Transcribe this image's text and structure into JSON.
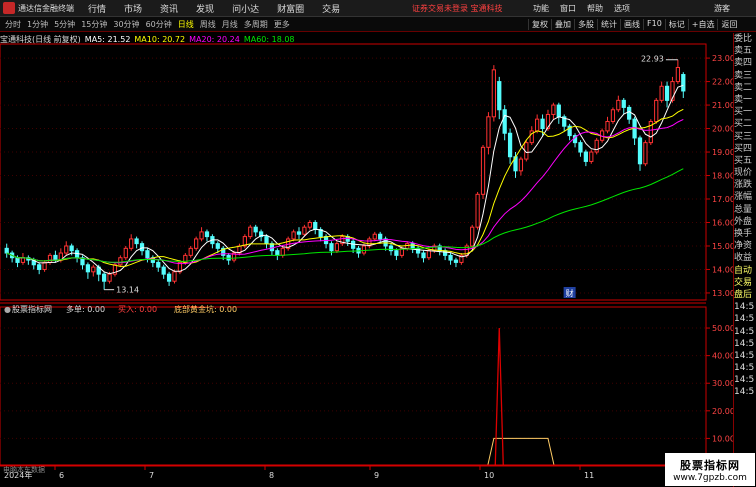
{
  "app": {
    "title": "通达信金融终端"
  },
  "menu": [
    "行情",
    "市场",
    "资讯",
    "发现",
    "问小达",
    "财富圈",
    "交易"
  ],
  "notice": "证券交易未登录  宝通科技",
  "menu_right": [
    "功能",
    "窗口",
    "帮助",
    "选项"
  ],
  "guest": "游客",
  "periods": [
    "分时",
    "1分钟",
    "5分钟",
    "15分钟",
    "30分钟",
    "60分钟",
    "日线",
    "周线",
    "月线",
    "多周期",
    "更多"
  ],
  "active_period": "日线",
  "tools": [
    "复权",
    "叠加",
    "多股",
    "统计",
    "画线",
    "F10",
    "标记",
    "+自选",
    "返回"
  ],
  "legend": {
    "name": "宝通科技(日线 前复权)",
    "ma5": "MA5: 21.52",
    "ma10": "MA10: 20.72",
    "ma20": "MA20: 20.24",
    "ma60": "MA60: 18.08"
  },
  "colors": {
    "up": "#ff3232",
    "down": "#54fcfc",
    "ma5": "#ffffff",
    "ma10": "#ffff00",
    "ma20": "#ff00ff",
    "ma60": "#00e600",
    "grid": "#400000",
    "axis": "#cc0000",
    "signal": "#dd0000",
    "gold": "#ffcc66"
  },
  "indicator": {
    "title": "股票指标网",
    "duo": "多单: 0.00",
    "buy": "买入: 0.00",
    "gold": "底部黄金坑: 0.00",
    "bottom": "电脑本车数据"
  },
  "quote_labels": [
    "委比",
    "卖五",
    "卖四",
    "卖三",
    "卖二",
    "卖一",
    "买一",
    "买二",
    "买三",
    "买四",
    "买五",
    "现价",
    "涨跌",
    "涨幅",
    "总量",
    "外盘",
    "换手",
    "净资",
    "收益",
    "自动",
    "交易",
    "盘后",
    "14:5",
    "14:5",
    "14:5",
    "14:5",
    "14:5",
    "14:5",
    "14:5",
    "14:5"
  ],
  "watermark": {
    "line1": "股票指标网",
    "line2": "www.7gpzb.com"
  },
  "cai_mark": "财",
  "chart_data": {
    "type": "candlestick",
    "y_ticks": [
      "23.00",
      "22.00",
      "21.00",
      "20.00",
      "19.00",
      "18.00",
      "17.00",
      "16.00",
      "15.00",
      "14.00",
      "13.00"
    ],
    "ylim": [
      12.7,
      23.6
    ],
    "x_labels": [
      "2024年",
      "6",
      "7",
      "8",
      "9",
      "10",
      "11"
    ],
    "high_label": "22.93",
    "low_label": "13.14",
    "candles": [
      [
        14.9,
        14.7,
        15.1,
        14.5
      ],
      [
        14.7,
        14.5,
        14.8,
        14.3
      ],
      [
        14.5,
        14.3,
        14.6,
        14.1
      ],
      [
        14.3,
        14.5,
        14.7,
        14.2
      ],
      [
        14.5,
        14.4,
        14.6,
        14.2
      ],
      [
        14.4,
        14.2,
        14.5,
        14.0
      ],
      [
        14.2,
        14.0,
        14.3,
        13.8
      ],
      [
        14.0,
        14.3,
        14.4,
        13.9
      ],
      [
        14.3,
        14.6,
        14.7,
        14.2
      ],
      [
        14.6,
        14.4,
        14.8,
        14.3
      ],
      [
        14.4,
        14.7,
        14.9,
        14.3
      ],
      [
        14.7,
        15.0,
        15.2,
        14.6
      ],
      [
        15.0,
        14.8,
        15.1,
        14.6
      ],
      [
        14.8,
        14.5,
        14.9,
        14.3
      ],
      [
        14.5,
        14.2,
        14.6,
        14.0
      ],
      [
        14.2,
        13.9,
        14.3,
        13.6
      ],
      [
        13.9,
        14.1,
        14.2,
        13.7
      ],
      [
        14.1,
        13.8,
        14.2,
        13.5
      ],
      [
        13.8,
        13.5,
        13.9,
        13.14
      ],
      [
        13.5,
        13.8,
        13.9,
        13.4
      ],
      [
        13.8,
        14.2,
        14.3,
        13.7
      ],
      [
        14.2,
        14.5,
        14.6,
        14.1
      ],
      [
        14.5,
        14.9,
        15.0,
        14.4
      ],
      [
        14.9,
        15.3,
        15.5,
        14.8
      ],
      [
        15.3,
        15.1,
        15.4,
        14.9
      ],
      [
        15.1,
        14.8,
        15.2,
        14.6
      ],
      [
        14.8,
        14.5,
        14.9,
        14.3
      ],
      [
        14.5,
        14.3,
        14.6,
        14.1
      ],
      [
        14.3,
        14.1,
        14.4,
        13.9
      ],
      [
        14.1,
        13.8,
        14.2,
        13.6
      ],
      [
        13.8,
        13.5,
        13.9,
        13.3
      ],
      [
        13.5,
        13.9,
        14.0,
        13.4
      ],
      [
        13.9,
        14.3,
        14.4,
        13.8
      ],
      [
        14.3,
        14.6,
        14.7,
        14.2
      ],
      [
        14.6,
        14.9,
        15.0,
        14.5
      ],
      [
        14.9,
        15.3,
        15.4,
        14.8
      ],
      [
        15.3,
        15.6,
        15.8,
        15.2
      ],
      [
        15.6,
        15.4,
        15.7,
        15.2
      ],
      [
        15.4,
        15.1,
        15.5,
        14.9
      ],
      [
        15.1,
        14.9,
        15.2,
        14.7
      ],
      [
        14.9,
        14.6,
        15.0,
        14.4
      ],
      [
        14.6,
        14.4,
        14.7,
        14.2
      ],
      [
        14.4,
        14.7,
        14.8,
        14.3
      ],
      [
        14.7,
        15.0,
        15.1,
        14.6
      ],
      [
        15.0,
        15.4,
        15.5,
        14.9
      ],
      [
        15.4,
        15.8,
        15.9,
        15.3
      ],
      [
        15.8,
        15.6,
        15.9,
        15.4
      ],
      [
        15.6,
        15.4,
        15.7,
        15.2
      ],
      [
        15.4,
        15.1,
        15.5,
        14.9
      ],
      [
        15.1,
        14.8,
        15.2,
        14.6
      ],
      [
        14.8,
        14.6,
        14.9,
        14.4
      ],
      [
        14.6,
        14.9,
        15.0,
        14.5
      ],
      [
        14.9,
        15.3,
        15.4,
        14.8
      ],
      [
        15.3,
        15.6,
        15.7,
        15.2
      ],
      [
        15.6,
        15.5,
        15.8,
        15.3
      ],
      [
        15.5,
        15.8,
        15.9,
        15.4
      ],
      [
        15.8,
        16.0,
        16.1,
        15.7
      ],
      [
        16.0,
        15.7,
        16.1,
        15.5
      ],
      [
        15.7,
        15.4,
        15.8,
        15.2
      ],
      [
        15.4,
        15.1,
        15.5,
        14.9
      ],
      [
        15.1,
        14.8,
        15.2,
        14.6
      ],
      [
        14.8,
        15.1,
        15.2,
        14.7
      ],
      [
        15.1,
        15.4,
        15.5,
        15.0
      ],
      [
        15.4,
        15.2,
        15.5,
        15.0
      ],
      [
        15.2,
        14.9,
        15.3,
        14.7
      ],
      [
        14.9,
        14.7,
        15.0,
        14.5
      ],
      [
        14.7,
        15.0,
        15.1,
        14.6
      ],
      [
        15.0,
        15.3,
        15.4,
        14.9
      ],
      [
        15.3,
        15.5,
        15.6,
        15.2
      ],
      [
        15.5,
        15.3,
        15.6,
        15.1
      ],
      [
        15.3,
        15.0,
        15.4,
        14.8
      ],
      [
        15.0,
        14.8,
        15.1,
        14.6
      ],
      [
        14.8,
        14.6,
        14.9,
        14.4
      ],
      [
        14.6,
        14.9,
        15.0,
        14.5
      ],
      [
        14.9,
        15.1,
        15.2,
        14.8
      ],
      [
        15.1,
        14.9,
        15.2,
        14.7
      ],
      [
        14.9,
        14.7,
        15.0,
        14.5
      ],
      [
        14.7,
        14.5,
        14.8,
        14.3
      ],
      [
        14.5,
        14.8,
        14.9,
        14.4
      ],
      [
        14.8,
        15.0,
        15.1,
        14.7
      ],
      [
        15.0,
        14.8,
        15.1,
        14.6
      ],
      [
        14.8,
        14.6,
        14.9,
        14.4
      ],
      [
        14.6,
        14.4,
        14.7,
        14.2
      ],
      [
        14.4,
        14.3,
        14.5,
        14.1
      ],
      [
        14.3,
        14.6,
        14.7,
        14.2
      ],
      [
        14.6,
        15.0,
        15.1,
        14.5
      ],
      [
        15.0,
        15.8,
        15.9,
        14.9
      ],
      [
        15.8,
        17.2,
        17.3,
        15.7
      ],
      [
        17.2,
        19.2,
        19.3,
        17.0
      ],
      [
        19.2,
        20.5,
        20.7,
        18.9
      ],
      [
        20.5,
        22.5,
        22.7,
        20.3
      ],
      [
        22.0,
        20.8,
        22.2,
        20.4
      ],
      [
        20.8,
        19.8,
        21.0,
        19.5
      ],
      [
        19.8,
        18.8,
        20.0,
        18.5
      ],
      [
        18.8,
        18.2,
        19.0,
        17.9
      ],
      [
        18.2,
        18.7,
        18.8,
        18.0
      ],
      [
        18.7,
        19.4,
        19.5,
        18.6
      ],
      [
        19.4,
        19.9,
        20.1,
        19.3
      ],
      [
        19.9,
        20.4,
        20.6,
        19.8
      ],
      [
        20.4,
        20.0,
        20.6,
        19.7
      ],
      [
        20.0,
        20.6,
        20.8,
        19.9
      ],
      [
        20.6,
        21.0,
        21.1,
        20.4
      ],
      [
        21.0,
        20.5,
        21.1,
        20.2
      ],
      [
        20.5,
        20.1,
        20.6,
        19.9
      ],
      [
        20.1,
        19.7,
        20.2,
        19.5
      ],
      [
        19.7,
        19.4,
        19.8,
        19.2
      ],
      [
        19.4,
        19.0,
        19.5,
        18.8
      ],
      [
        19.0,
        18.6,
        19.1,
        18.4
      ],
      [
        18.6,
        19.0,
        19.1,
        18.5
      ],
      [
        19.0,
        19.5,
        19.6,
        18.9
      ],
      [
        19.5,
        19.9,
        20.0,
        19.4
      ],
      [
        19.9,
        20.3,
        20.5,
        19.8
      ],
      [
        20.3,
        20.8,
        20.9,
        20.2
      ],
      [
        20.8,
        21.2,
        21.4,
        20.7
      ],
      [
        21.2,
        20.9,
        21.3,
        20.6
      ],
      [
        20.9,
        20.4,
        21.0,
        20.2
      ],
      [
        20.4,
        19.6,
        20.5,
        19.3
      ],
      [
        19.6,
        18.5,
        19.7,
        18.2
      ],
      [
        18.5,
        19.4,
        19.5,
        18.4
      ],
      [
        19.4,
        20.3,
        20.4,
        19.3
      ],
      [
        20.3,
        21.2,
        21.3,
        20.2
      ],
      [
        21.2,
        21.8,
        22.0,
        21.1
      ],
      [
        21.8,
        21.2,
        22.0,
        20.9
      ],
      [
        21.2,
        22.0,
        22.2,
        21.1
      ],
      [
        22.0,
        22.6,
        22.93,
        21.9
      ],
      [
        22.3,
        21.6,
        22.4,
        21.3
      ]
    ],
    "signal_peak": 50,
    "signal_index": 91,
    "gold_start": 90,
    "gold_end": 100,
    "gold_level": 10,
    "ind_ticks": [
      "50.00",
      "40.00",
      "30.00",
      "20.00",
      "10.00"
    ],
    "ind_ylim": [
      0,
      54
    ]
  }
}
